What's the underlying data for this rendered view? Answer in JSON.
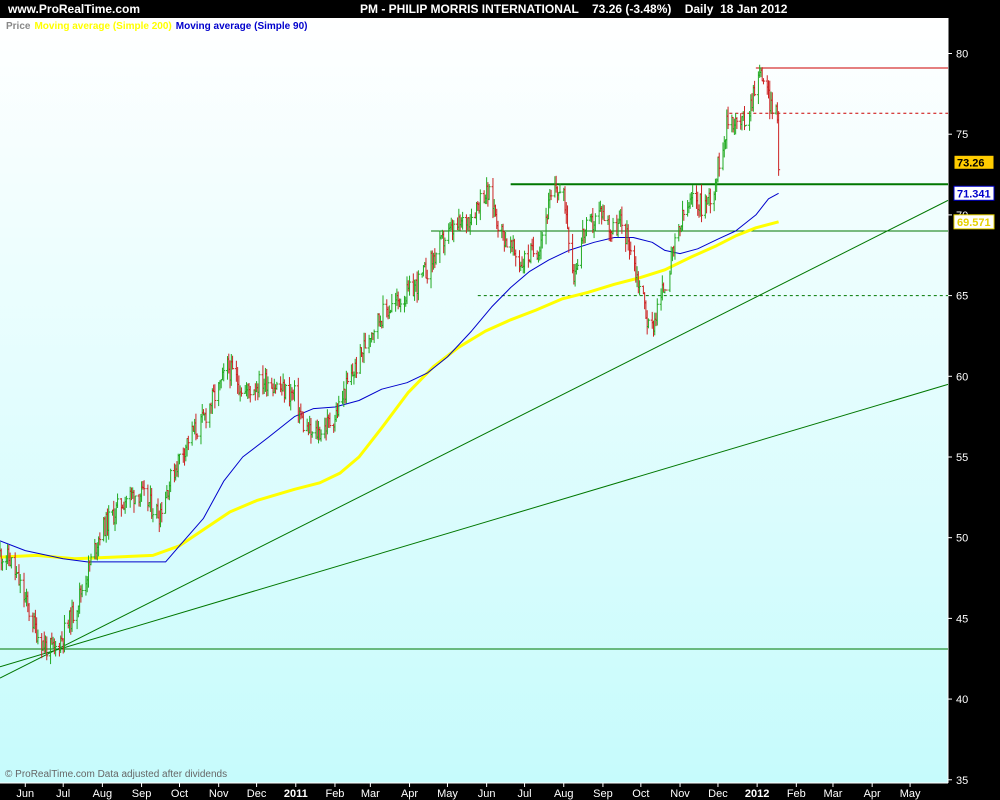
{
  "header": {
    "site": "www.ProRealTime.com",
    "instrument_title": "PM - PHILIP MORRIS INTERNATIONAL    73.26 (-3.48%)    Daily  18 Jan 2012"
  },
  "legend": {
    "price_label": "Price",
    "ma200_label": "Moving average (Simple 200)",
    "ma90_label": "Moving average (Simple 90)"
  },
  "footer": {
    "note": "© ProRealTime.com  Data adjusted after dividends"
  },
  "colors": {
    "up_bar": "#22aa22",
    "down_bar": "#cc2222",
    "ma200": "#ffff00",
    "ma90": "#0000cc",
    "ma_cross": "#cc0000",
    "trendline": "#007700",
    "resistance_red": "#cc0000",
    "price_badge": "#ffcc00",
    "plot_bg_top": "#ffffff",
    "plot_bg_bottom": "#c6fbfc"
  },
  "chart_data": {
    "type": "line",
    "title": "PM - PHILIP MORRIS INTERNATIONAL",
    "x_tick_labels": [
      "Jun",
      "Jul",
      "Aug",
      "Sep",
      "Oct",
      "Nov",
      "Dec",
      "2011",
      "Feb",
      "Mar",
      "Apr",
      "May",
      "Jun",
      "Jul",
      "Aug",
      "Sep",
      "Oct",
      "Nov",
      "Dec",
      "2012",
      "Feb",
      "Mar",
      "Apr",
      "May"
    ],
    "x_range": [
      "2010-05-12",
      "2012-05-31"
    ],
    "y_ticks": [
      35,
      40,
      45,
      50,
      55,
      60,
      65,
      70,
      75,
      80
    ],
    "ylim": [
      34.8,
      82.2
    ],
    "last_values": {
      "price": "73.26",
      "ma90": "71.341",
      "ma200": "69.571"
    },
    "price_path": [
      [
        "2010-05-12",
        49.0
      ],
      [
        "2010-05-20",
        48.6
      ],
      [
        "2010-05-28",
        47.0
      ],
      [
        "2010-06-05",
        45.2
      ],
      [
        "2010-06-12",
        43.8
      ],
      [
        "2010-06-18",
        43.2
      ],
      [
        "2010-06-24",
        43.0
      ],
      [
        "2010-07-01",
        44.0
      ],
      [
        "2010-07-10",
        45.5
      ],
      [
        "2010-07-20",
        47.8
      ],
      [
        "2010-07-30",
        50.3
      ],
      [
        "2010-08-10",
        51.5
      ],
      [
        "2010-08-20",
        52.5
      ],
      [
        "2010-08-30",
        52.8
      ],
      [
        "2010-09-08",
        52.0
      ],
      [
        "2010-09-15",
        51.5
      ],
      [
        "2010-09-22",
        53.2
      ],
      [
        "2010-10-01",
        55.0
      ],
      [
        "2010-10-10",
        56.4
      ],
      [
        "2010-10-18",
        57.0
      ],
      [
        "2010-10-26",
        58.4
      ],
      [
        "2010-11-02",
        59.3
      ],
      [
        "2010-11-08",
        60.6
      ],
      [
        "2010-11-15",
        59.8
      ],
      [
        "2010-11-22",
        59.0
      ],
      [
        "2010-12-01",
        59.5
      ],
      [
        "2010-12-10",
        59.8
      ],
      [
        "2010-12-20",
        59.2
      ],
      [
        "2010-12-31",
        58.8
      ],
      [
        "2011-01-07",
        57.0
      ],
      [
        "2011-01-14",
        56.3
      ],
      [
        "2011-01-22",
        56.7
      ],
      [
        "2011-02-01",
        57.5
      ],
      [
        "2011-02-10",
        59.3
      ],
      [
        "2011-02-20",
        61.0
      ],
      [
        "2011-03-01",
        62.8
      ],
      [
        "2011-03-10",
        63.8
      ],
      [
        "2011-03-20",
        64.5
      ],
      [
        "2011-04-01",
        65.2
      ],
      [
        "2011-04-10",
        66.0
      ],
      [
        "2011-04-20",
        67.3
      ],
      [
        "2011-04-30",
        68.7
      ],
      [
        "2011-05-10",
        69.3
      ],
      [
        "2011-05-20",
        70.0
      ],
      [
        "2011-05-30",
        71.4
      ],
      [
        "2011-06-05",
        71.0
      ],
      [
        "2011-06-12",
        69.0
      ],
      [
        "2011-06-20",
        68.0
      ],
      [
        "2011-06-28",
        67.0
      ],
      [
        "2011-07-05",
        67.5
      ],
      [
        "2011-07-12",
        68.0
      ],
      [
        "2011-07-20",
        70.5
      ],
      [
        "2011-07-26",
        71.7
      ],
      [
        "2011-08-02",
        70.8
      ],
      [
        "2011-08-09",
        66.3
      ],
      [
        "2011-08-16",
        68.8
      ],
      [
        "2011-08-24",
        69.5
      ],
      [
        "2011-08-31",
        70.3
      ],
      [
        "2011-09-08",
        69.0
      ],
      [
        "2011-09-15",
        69.5
      ],
      [
        "2011-09-22",
        68.3
      ],
      [
        "2011-09-28",
        66.2
      ],
      [
        "2011-10-04",
        64.5
      ],
      [
        "2011-10-08",
        62.5
      ],
      [
        "2011-10-14",
        64.2
      ],
      [
        "2011-10-22",
        66.2
      ],
      [
        "2011-10-28",
        68.0
      ],
      [
        "2011-11-04",
        70.0
      ],
      [
        "2011-11-12",
        71.0
      ],
      [
        "2011-11-20",
        70.5
      ],
      [
        "2011-11-28",
        71.7
      ],
      [
        "2011-12-04",
        74.2
      ],
      [
        "2011-12-10",
        76.2
      ],
      [
        "2011-12-18",
        75.5
      ],
      [
        "2011-12-25",
        76.2
      ],
      [
        "2011-12-31",
        78.4
      ],
      [
        "2012-01-05",
        78.8
      ],
      [
        "2012-01-10",
        77.2
      ],
      [
        "2012-01-14",
        76.6
      ],
      [
        "2012-01-17",
        75.9
      ],
      [
        "2012-01-18",
        73.26
      ]
    ],
    "ma90_path": [
      [
        "2010-05-12",
        49.8
      ],
      [
        "2010-06-01",
        49.2
      ],
      [
        "2010-07-01",
        48.7
      ],
      [
        "2010-07-20",
        48.5
      ],
      [
        "2010-08-15",
        48.5
      ],
      [
        "2010-09-01",
        48.5
      ],
      [
        "2010-09-20",
        48.5
      ],
      [
        "2010-10-01",
        49.5
      ],
      [
        "2010-10-20",
        51.2
      ],
      [
        "2010-11-05",
        53.5
      ],
      [
        "2010-11-20",
        55.0
      ],
      [
        "2010-12-10",
        56.2
      ],
      [
        "2010-12-31",
        57.5
      ],
      [
        "2011-01-15",
        58.0
      ],
      [
        "2011-02-01",
        58.1
      ],
      [
        "2011-02-20",
        58.5
      ],
      [
        "2011-03-10",
        59.2
      ],
      [
        "2011-03-30",
        59.6
      ],
      [
        "2011-04-15",
        60.2
      ],
      [
        "2011-05-01",
        61.2
      ],
      [
        "2011-05-20",
        62.8
      ],
      [
        "2011-06-05",
        64.3
      ],
      [
        "2011-06-20",
        65.5
      ],
      [
        "2011-07-05",
        66.5
      ],
      [
        "2011-07-20",
        67.2
      ],
      [
        "2011-08-05",
        67.8
      ],
      [
        "2011-08-25",
        68.3
      ],
      [
        "2011-09-10",
        68.6
      ],
      [
        "2011-09-25",
        68.6
      ],
      [
        "2011-10-10",
        68.3
      ],
      [
        "2011-10-20",
        67.8
      ],
      [
        "2011-11-01",
        67.6
      ],
      [
        "2011-11-15",
        67.9
      ],
      [
        "2011-12-01",
        68.5
      ],
      [
        "2011-12-15",
        69.0
      ],
      [
        "2011-12-31",
        70.0
      ],
      [
        "2012-01-10",
        71.0
      ],
      [
        "2012-01-18",
        71.341
      ]
    ],
    "ma200_path": [
      [
        "2010-05-12",
        48.8
      ],
      [
        "2010-06-10",
        48.9
      ],
      [
        "2010-07-10",
        48.7
      ],
      [
        "2010-08-10",
        48.8
      ],
      [
        "2010-09-10",
        48.9
      ],
      [
        "2010-10-01",
        49.5
      ],
      [
        "2010-10-20",
        50.5
      ],
      [
        "2010-11-10",
        51.6
      ],
      [
        "2010-12-01",
        52.3
      ],
      [
        "2010-12-31",
        53.0
      ],
      [
        "2011-01-20",
        53.4
      ],
      [
        "2011-02-05",
        54.0
      ],
      [
        "2011-02-20",
        55.0
      ],
      [
        "2011-03-10",
        56.8
      ],
      [
        "2011-03-31",
        59.0
      ],
      [
        "2011-04-20",
        60.6
      ],
      [
        "2011-05-10",
        61.8
      ],
      [
        "2011-05-31",
        62.8
      ],
      [
        "2011-06-20",
        63.5
      ],
      [
        "2011-07-10",
        64.1
      ],
      [
        "2011-07-31",
        64.8
      ],
      [
        "2011-08-20",
        65.2
      ],
      [
        "2011-09-10",
        65.7
      ],
      [
        "2011-09-30",
        66.1
      ],
      [
        "2011-10-20",
        66.6
      ],
      [
        "2011-11-10",
        67.4
      ],
      [
        "2011-11-30",
        68.1
      ],
      [
        "2011-12-15",
        68.7
      ],
      [
        "2011-12-31",
        69.2
      ],
      [
        "2012-01-18",
        69.571
      ]
    ],
    "horizontal_lines": [
      {
        "y": 43.1,
        "from": "2010-05-12",
        "color": "green",
        "style": "solid"
      },
      {
        "y": 69.0,
        "from": "2011-04-18",
        "color": "green",
        "style": "solid"
      },
      {
        "y": 71.9,
        "from": "2011-06-20",
        "color": "green",
        "style": "solid",
        "thick": true
      },
      {
        "y": 65.0,
        "from": "2011-05-25",
        "color": "green",
        "style": "dashed"
      },
      {
        "y": 79.1,
        "from": "2011-12-31",
        "color": "red",
        "style": "solid"
      },
      {
        "y": 76.3,
        "from": "2011-12-10",
        "color": "red",
        "style": "dashed"
      }
    ],
    "trendlines": [
      {
        "x1": "2010-05-12",
        "y1": 41.3,
        "x2": "2012-05-31",
        "y2": 70.9
      },
      {
        "x1": "2010-05-12",
        "y1": 42.0,
        "x2": "2012-05-31",
        "y2": 59.5
      }
    ]
  }
}
